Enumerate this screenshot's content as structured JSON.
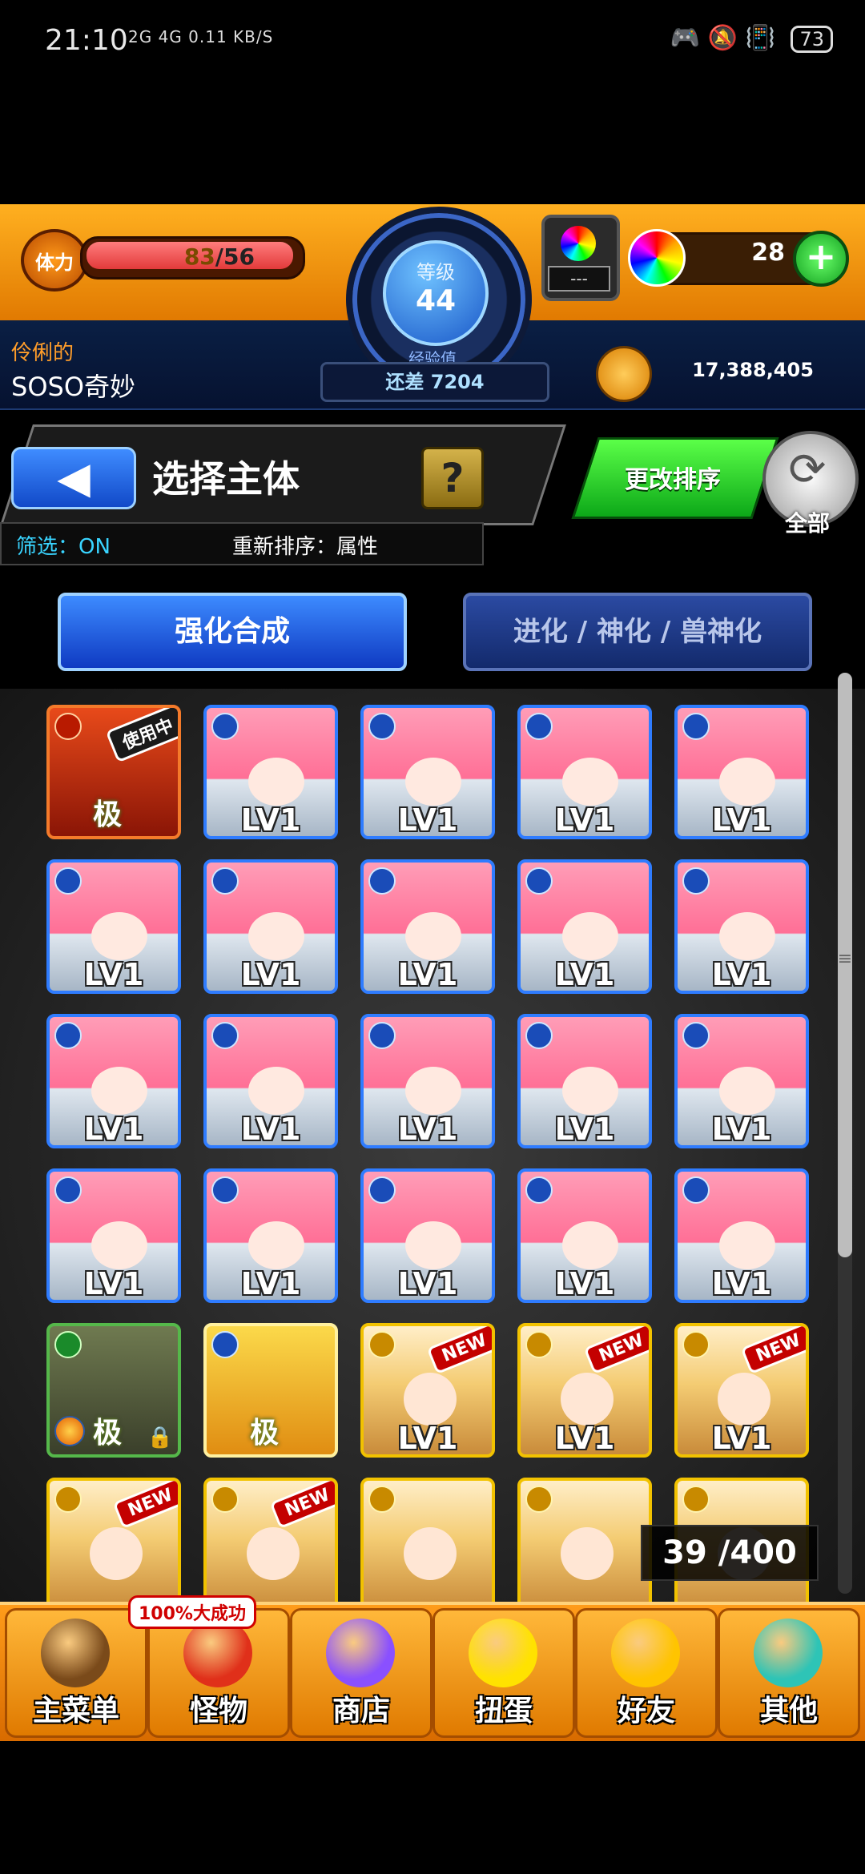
{
  "status": {
    "time": "21:10",
    "net": "2G 4G 0.11 KB/S",
    "battery": "73"
  },
  "header": {
    "stamina_label": "体力",
    "stamina_current": "83",
    "stamina_max": "/56",
    "level_label": "等级",
    "level": "44",
    "exp_label": "经验值",
    "exp_remaining": "还差 7204",
    "gacha_placeholder": "---",
    "orbs": "28",
    "plus": "+",
    "player_title": "伶俐的",
    "player_name": "SOSO奇妙",
    "gold": "17,388,405"
  },
  "panel": {
    "back_icon": "◀",
    "title": "选择主体",
    "help": "?",
    "filter": "筛选：ON",
    "resort": "重新排序：属性",
    "sort_button": "更改排序",
    "all_button": "全部",
    "all_icon": "⟳"
  },
  "tabs": {
    "enhance": "强化合成",
    "evolve": "进化 / 神化 / 兽神化"
  },
  "monsters": [
    {
      "kind": "fire",
      "tag": "使用中",
      "badge": "极",
      "lv": ""
    },
    {
      "kind": "water",
      "lv": "LV1"
    },
    {
      "kind": "water",
      "lv": "LV1"
    },
    {
      "kind": "water",
      "lv": "LV1"
    },
    {
      "kind": "water",
      "lv": "LV1"
    },
    {
      "kind": "water",
      "lv": "LV1"
    },
    {
      "kind": "water",
      "lv": "LV1"
    },
    {
      "kind": "water",
      "lv": "LV1"
    },
    {
      "kind": "water",
      "lv": "LV1"
    },
    {
      "kind": "water",
      "lv": "LV1"
    },
    {
      "kind": "water",
      "lv": "LV1"
    },
    {
      "kind": "water",
      "lv": "LV1"
    },
    {
      "kind": "water",
      "lv": "LV1"
    },
    {
      "kind": "water",
      "lv": "LV1"
    },
    {
      "kind": "water",
      "lv": "LV1"
    },
    {
      "kind": "water",
      "lv": "LV1"
    },
    {
      "kind": "water",
      "lv": "LV1"
    },
    {
      "kind": "water",
      "lv": "LV1"
    },
    {
      "kind": "water",
      "lv": "LV1"
    },
    {
      "kind": "water",
      "lv": "LV1"
    },
    {
      "kind": "wood",
      "badge": "极",
      "lock": "🔒",
      "lv": ""
    },
    {
      "kind": "frog",
      "badge": "极",
      "lv": ""
    },
    {
      "kind": "light",
      "tag": "NEW",
      "lv": "LV1"
    },
    {
      "kind": "light",
      "tag": "NEW",
      "lv": "LV1"
    },
    {
      "kind": "light",
      "tag": "NEW",
      "lv": "LV1"
    },
    {
      "kind": "light",
      "tag": "NEW",
      "lv": ""
    },
    {
      "kind": "light",
      "tag": "NEW",
      "lv": ""
    },
    {
      "kind": "light",
      "lv": ""
    },
    {
      "kind": "light",
      "lv": ""
    },
    {
      "kind": "light",
      "lv": ""
    }
  ],
  "box_count": "39 /400",
  "nav": {
    "promo": "100%大成功",
    "items": [
      {
        "label": "主菜单",
        "icon": "castle-icon",
        "color": "#7a4a1a"
      },
      {
        "label": "怪物",
        "icon": "monster-icon",
        "color": "#e0301a"
      },
      {
        "label": "商店",
        "icon": "orb-icon",
        "color": "#8a50ff"
      },
      {
        "label": "扭蛋",
        "icon": "egg-icon",
        "color": "#ffe200"
      },
      {
        "label": "好友",
        "icon": "friends-icon",
        "color": "#ffc400"
      },
      {
        "label": "其他",
        "icon": "other-icon",
        "color": "#2ec4b6"
      }
    ]
  }
}
